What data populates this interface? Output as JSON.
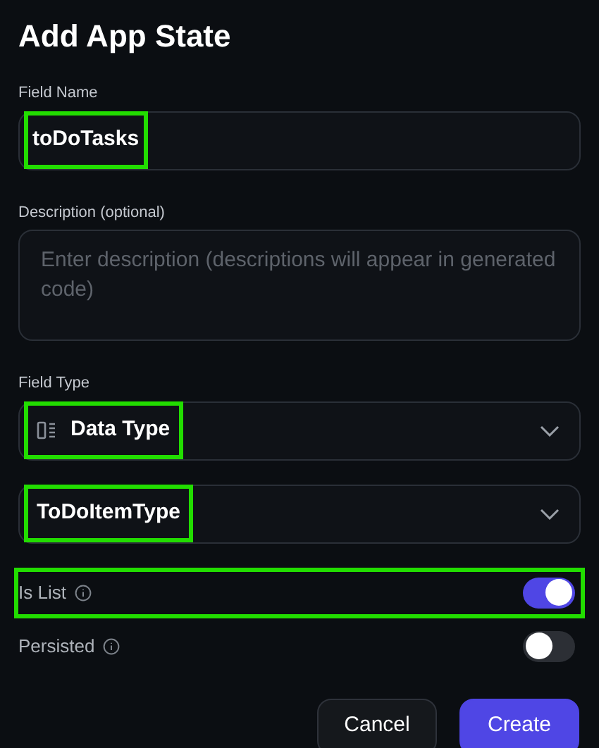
{
  "title": "Add App State",
  "field_name": {
    "label": "Field Name",
    "value": "toDoTasks",
    "highlighted": true
  },
  "description": {
    "label": "Description (optional)",
    "placeholder": "Enter description (descriptions will appear in generated code)"
  },
  "field_type": {
    "label": "Field Type",
    "dropdowns": [
      {
        "value": "Data Type",
        "highlighted": true,
        "kind": "icon"
      },
      {
        "value": "ToDoItemType",
        "highlighted": true,
        "kind": "plain"
      }
    ]
  },
  "toggles": [
    {
      "label": "Is List",
      "on": true,
      "highlighted": true
    },
    {
      "label": "Persisted",
      "on": false,
      "highlighted": false
    }
  ],
  "buttons": [
    {
      "label": "Cancel",
      "kind": "secondary"
    },
    {
      "label": "Create",
      "kind": "primary"
    }
  ]
}
